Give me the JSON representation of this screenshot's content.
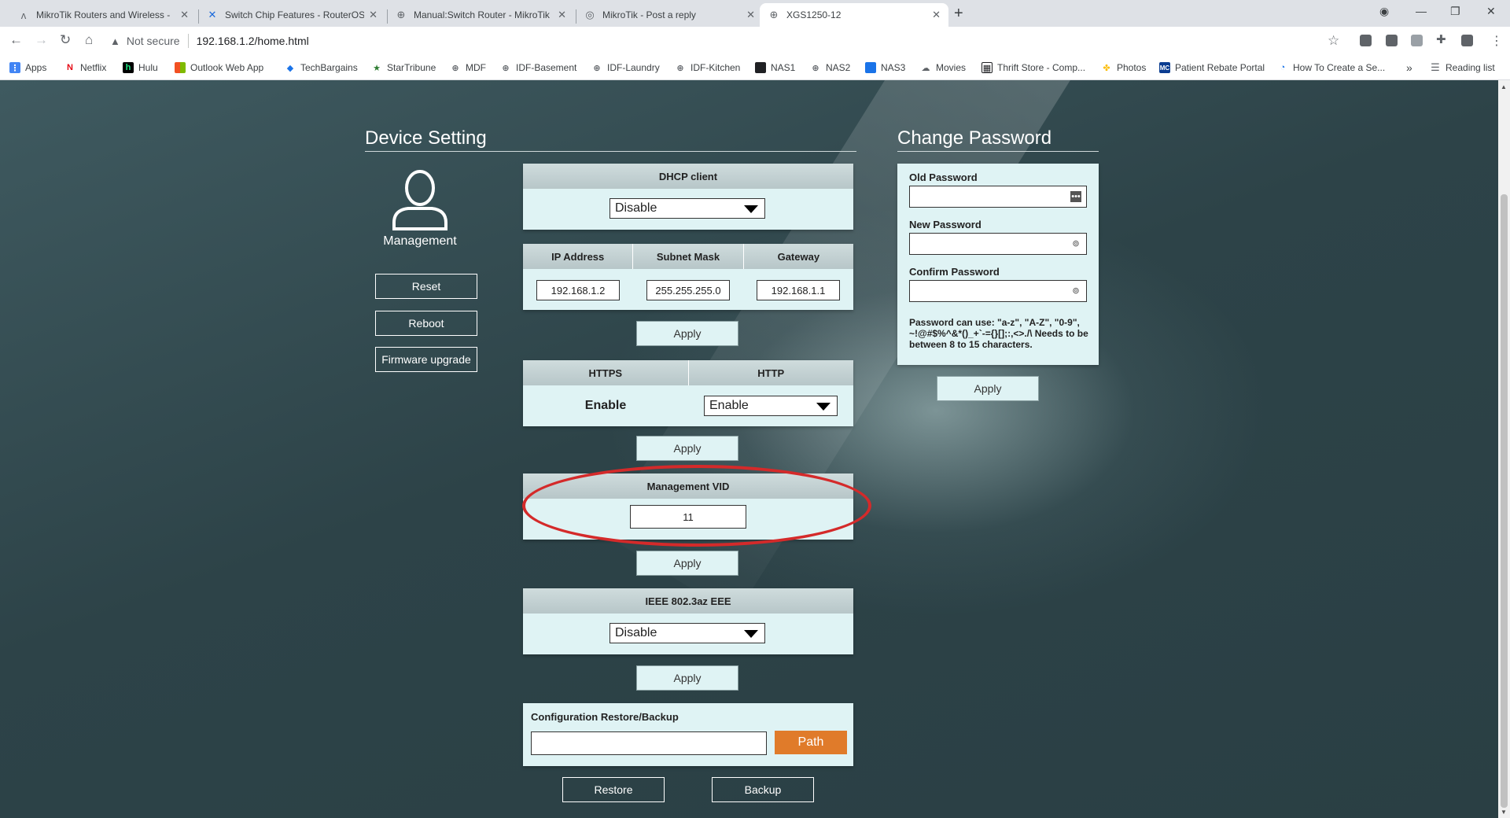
{
  "browser": {
    "tabs": [
      {
        "title": "MikroTik Routers and Wireless - ",
        "icon": "mikrotik-icon"
      },
      {
        "title": "Switch Chip Features - RouterOS",
        "icon": "confluence-icon"
      },
      {
        "title": "Manual:Switch Router - MikroTik",
        "icon": "globe-icon"
      },
      {
        "title": "MikroTik - Post a reply",
        "icon": "forum-icon"
      },
      {
        "title": "XGS1250-12",
        "icon": "globe-icon"
      }
    ],
    "address": {
      "security": "Not secure",
      "url": "192.168.1.2/home.html"
    },
    "bookmarks": [
      {
        "label": "Apps",
        "icon": "apps-icon",
        "color": "#4285f4"
      },
      {
        "label": "Netflix",
        "icon": "netflix-icon",
        "color": "#e50914"
      },
      {
        "label": "Hulu",
        "icon": "hulu-icon",
        "color": "#1ce783"
      },
      {
        "label": "Outlook Web App",
        "icon": "office-icon",
        "color": "#f25022"
      },
      {
        "label": "TechBargains",
        "icon": "tag-icon",
        "color": "#1a73e8"
      },
      {
        "label": "StarTribune",
        "icon": "star-icon",
        "color": "#2e7d32"
      },
      {
        "label": "MDF",
        "icon": "globe-icon",
        "color": "#5f6368"
      },
      {
        "label": "IDF-Basement",
        "icon": "globe-icon",
        "color": "#5f6368"
      },
      {
        "label": "IDF-Laundry",
        "icon": "globe-icon",
        "color": "#5f6368"
      },
      {
        "label": "IDF-Kitchen",
        "icon": "globe-icon",
        "color": "#5f6368"
      },
      {
        "label": "NAS1",
        "icon": "nas-icon",
        "color": "#202124"
      },
      {
        "label": "NAS2",
        "icon": "globe-icon",
        "color": "#5f6368"
      },
      {
        "label": "NAS3",
        "icon": "nas-icon",
        "color": "#1a73e8"
      },
      {
        "label": "Movies",
        "icon": "cloud-icon",
        "color": "#5f6368"
      },
      {
        "label": "Thrift Store - Comp...",
        "icon": "grid-icon",
        "color": "#202124"
      },
      {
        "label": "Photos",
        "icon": "pinwheel-icon",
        "color": "#fbbc04"
      },
      {
        "label": "Patient Rebate Portal",
        "icon": "mc-icon",
        "color": "#0b3d91"
      },
      {
        "label": "How To Create a Se...",
        "icon": "circle-icon",
        "color": "#1a73e8"
      }
    ],
    "more": "»",
    "reading_list": "Reading list"
  },
  "device_setting": {
    "title": "Device Setting",
    "management_label": "Management",
    "buttons": {
      "reset": "Reset",
      "reboot": "Reboot",
      "firmware": "Firmware upgrade"
    },
    "dhcp": {
      "header": "DHCP client",
      "value": "Disable"
    },
    "ip": {
      "headers": [
        "IP Address",
        "Subnet Mask",
        "Gateway"
      ],
      "values": [
        "192.168.1.2",
        "255.255.255.0",
        "192.168.1.1"
      ]
    },
    "web": {
      "headers": [
        "HTTPS",
        "HTTP"
      ],
      "https_value": "Enable",
      "http_value": "Enable"
    },
    "vid": {
      "header": "Management VID",
      "value": "11"
    },
    "eee": {
      "header": "IEEE 802.3az EEE",
      "value": "Disable"
    },
    "config": {
      "header": "Configuration Restore/Backup",
      "path_button": "Path",
      "restore": "Restore",
      "backup": "Backup"
    },
    "apply": "Apply"
  },
  "change_password": {
    "title": "Change Password",
    "old_label": "Old Password",
    "new_label": "New Password",
    "confirm_label": "Confirm Password",
    "note": "Password can use: \"a-z\", \"A-Z\", \"0-9\", ~!@#$%^&*()_+`-={}[];:,<>./\\ Needs to be between 8 to 15 characters.",
    "apply": "Apply"
  },
  "colors": {
    "accent": "#e07b2a",
    "panel": "#dff3f4",
    "annotation": "#d42a2a",
    "background": "#2d4348"
  }
}
